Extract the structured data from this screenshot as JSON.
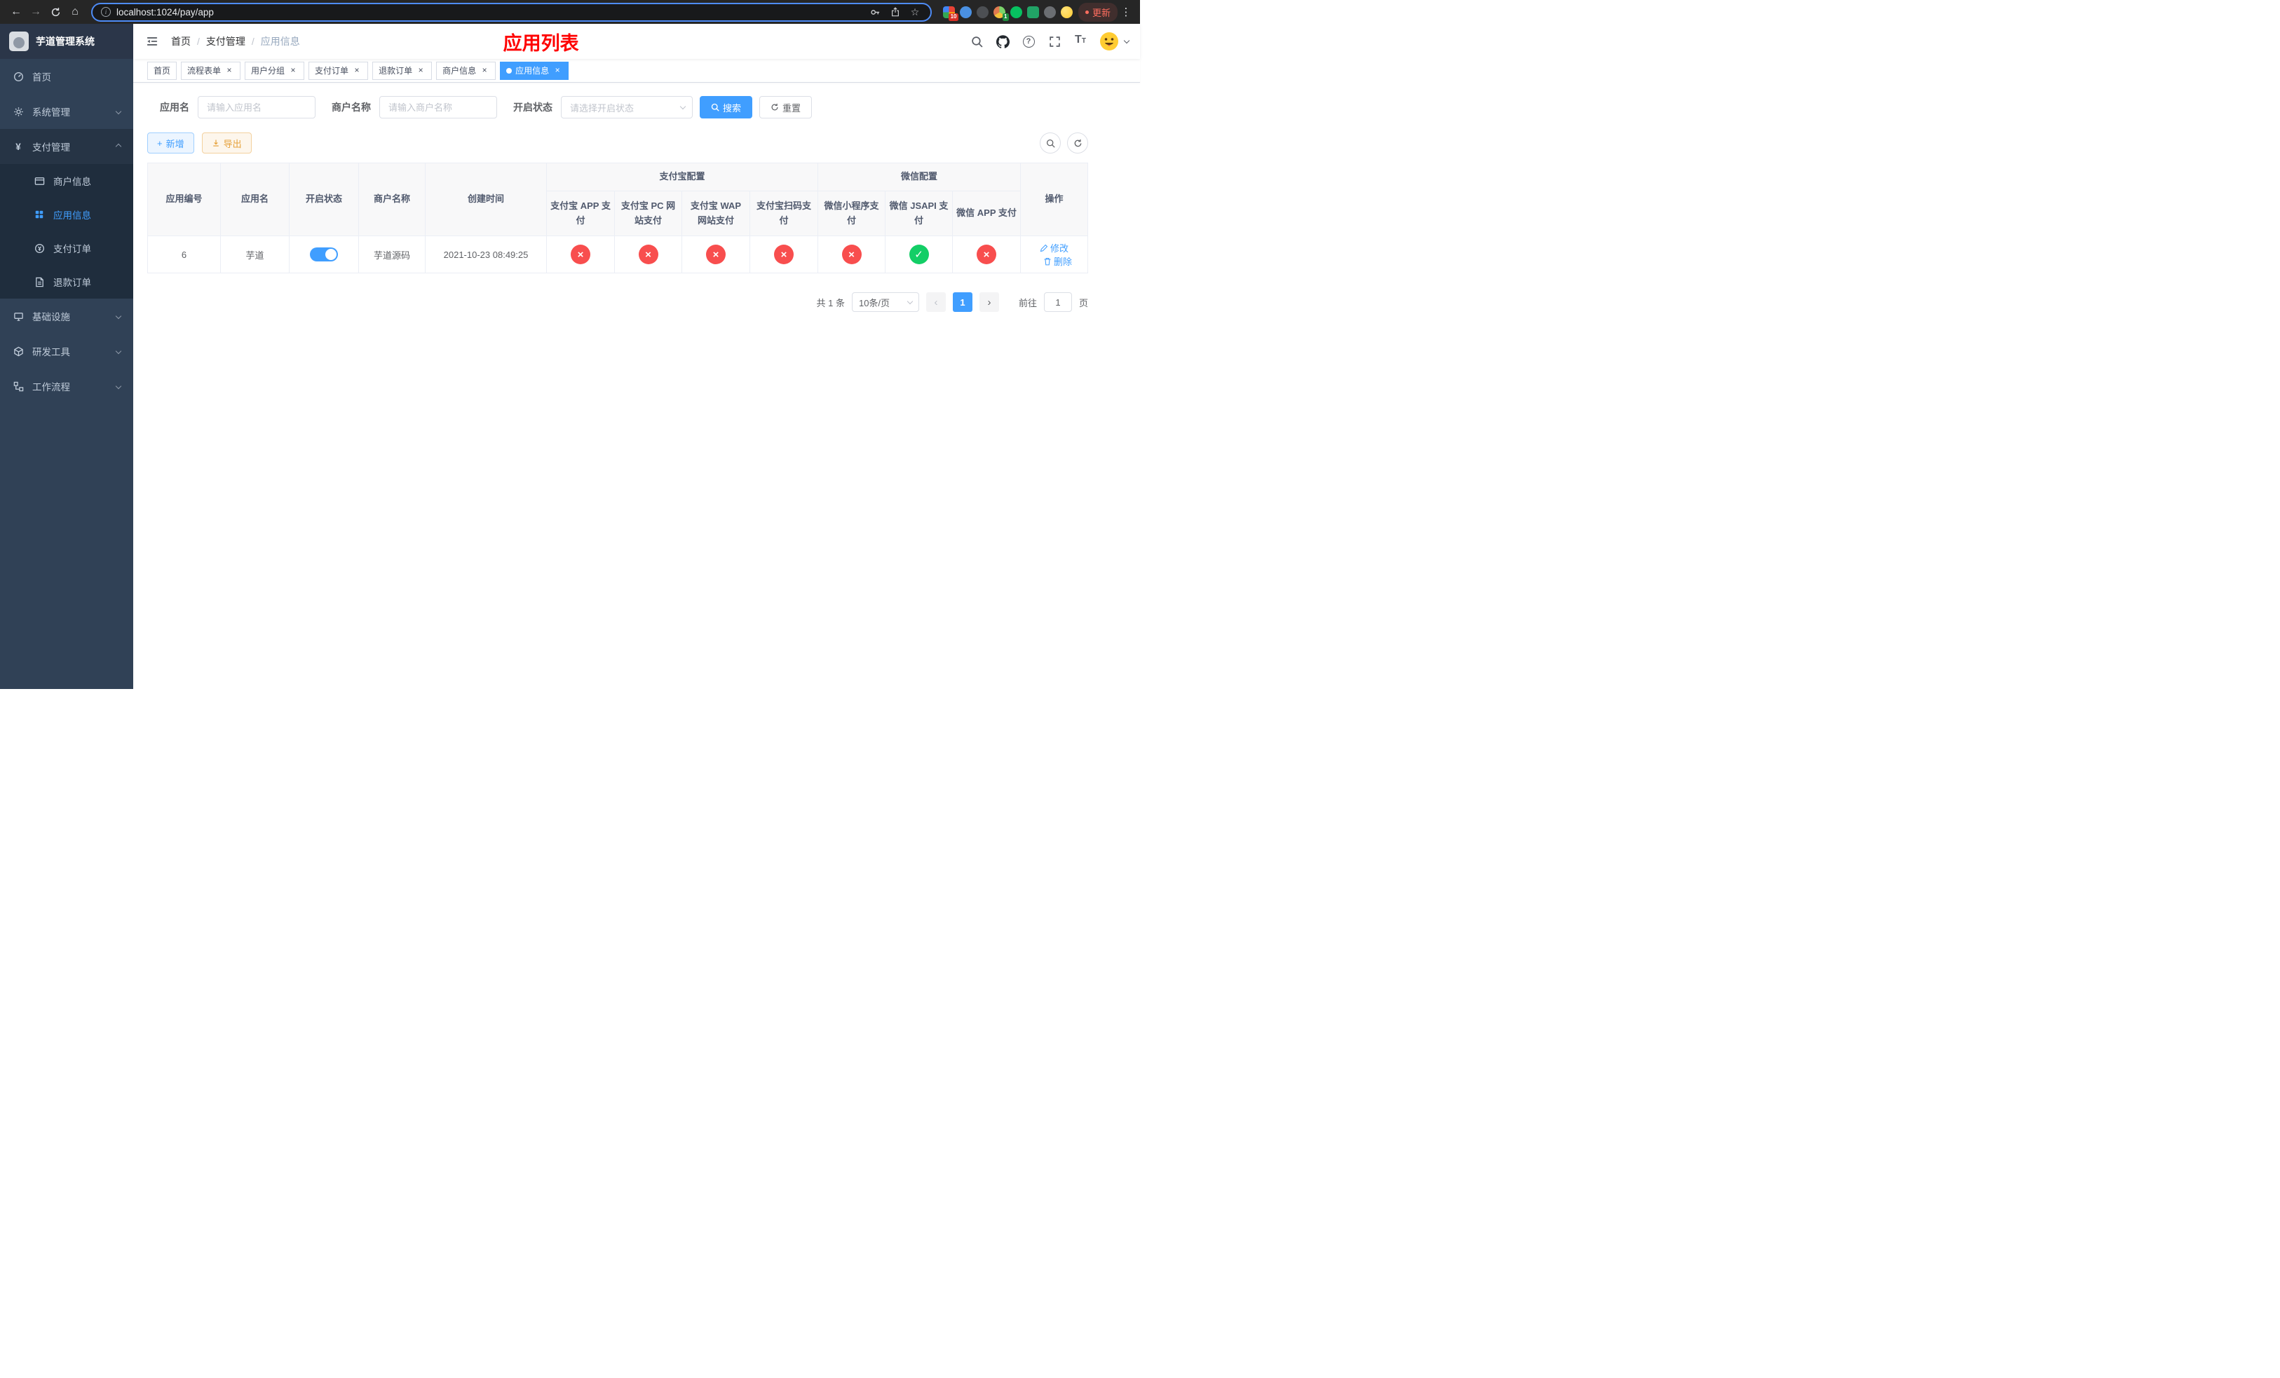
{
  "browser": {
    "url": "localhost:1024/pay/app",
    "update_label": "更新",
    "extension_badge_1": "10",
    "extension_badge_2": "1"
  },
  "icons": {
    "back": "←",
    "forward": "→",
    "home": "⌂",
    "info": "i",
    "star": "☆",
    "menu_dots": "⋮",
    "plus": "+",
    "help": "?",
    "font_large": "T",
    "font_small": "T",
    "yuan": "¥",
    "prev": "‹",
    "next": "›",
    "close": "×"
  },
  "sidebar": {
    "title": "芋道管理系统",
    "menu": [
      {
        "label": "首页"
      },
      {
        "label": "系统管理"
      },
      {
        "label": "支付管理"
      },
      {
        "label": "基础设施"
      },
      {
        "label": "研发工具"
      },
      {
        "label": "工作流程"
      }
    ],
    "submenu": [
      {
        "label": "商户信息"
      },
      {
        "label": "应用信息"
      },
      {
        "label": "支付订单"
      },
      {
        "label": "退款订单"
      }
    ]
  },
  "header": {
    "breadcrumb": [
      "首页",
      "支付管理",
      "应用信息"
    ],
    "page_title": "应用列表"
  },
  "tabs": [
    {
      "label": "首页",
      "closable": false,
      "active": false
    },
    {
      "label": "流程表单",
      "closable": true,
      "active": false
    },
    {
      "label": "用户分组",
      "closable": true,
      "active": false
    },
    {
      "label": "支付订单",
      "closable": true,
      "active": false
    },
    {
      "label": "退款订单",
      "closable": true,
      "active": false
    },
    {
      "label": "商户信息",
      "closable": true,
      "active": false
    },
    {
      "label": "应用信息",
      "closable": true,
      "active": true
    }
  ],
  "filters": {
    "app_name_label": "应用名",
    "app_name_placeholder": "请输入应用名",
    "merchant_label": "商户名称",
    "merchant_placeholder": "请输入商户名称",
    "status_label": "开启状态",
    "status_placeholder": "请选择开启状态",
    "search_label": "搜索",
    "reset_label": "重置"
  },
  "toolbar": {
    "add_label": "新增",
    "export_label": "导出"
  },
  "table": {
    "headers_main": [
      "应用编号",
      "应用名",
      "开启状态",
      "商户名称",
      "创建时间"
    ],
    "group_alipay": "支付宝配置",
    "group_wechat": "微信配置",
    "headers_alipay": [
      "支付宝 APP 支付",
      "支付宝 PC 网站支付",
      "支付宝 WAP 网站支付",
      "支付宝扫码支付"
    ],
    "headers_wechat": [
      "微信小程序支付",
      "微信 JSAPI 支付",
      "微信 APP 支付"
    ],
    "header_actions": "操作",
    "row": {
      "id": "6",
      "name": "芋道",
      "enabled": true,
      "merchant": "芋道源码",
      "created": "2021-10-23 08:49:25",
      "configs": [
        false,
        false,
        false,
        false,
        false,
        true,
        false
      ],
      "edit_label": "修改",
      "delete_label": "删除"
    }
  },
  "pagination": {
    "total": "共 1 条",
    "page_size": "10条/页",
    "current_page": "1",
    "goto_label": "前往",
    "goto_value": "1",
    "unit_label": "页"
  }
}
